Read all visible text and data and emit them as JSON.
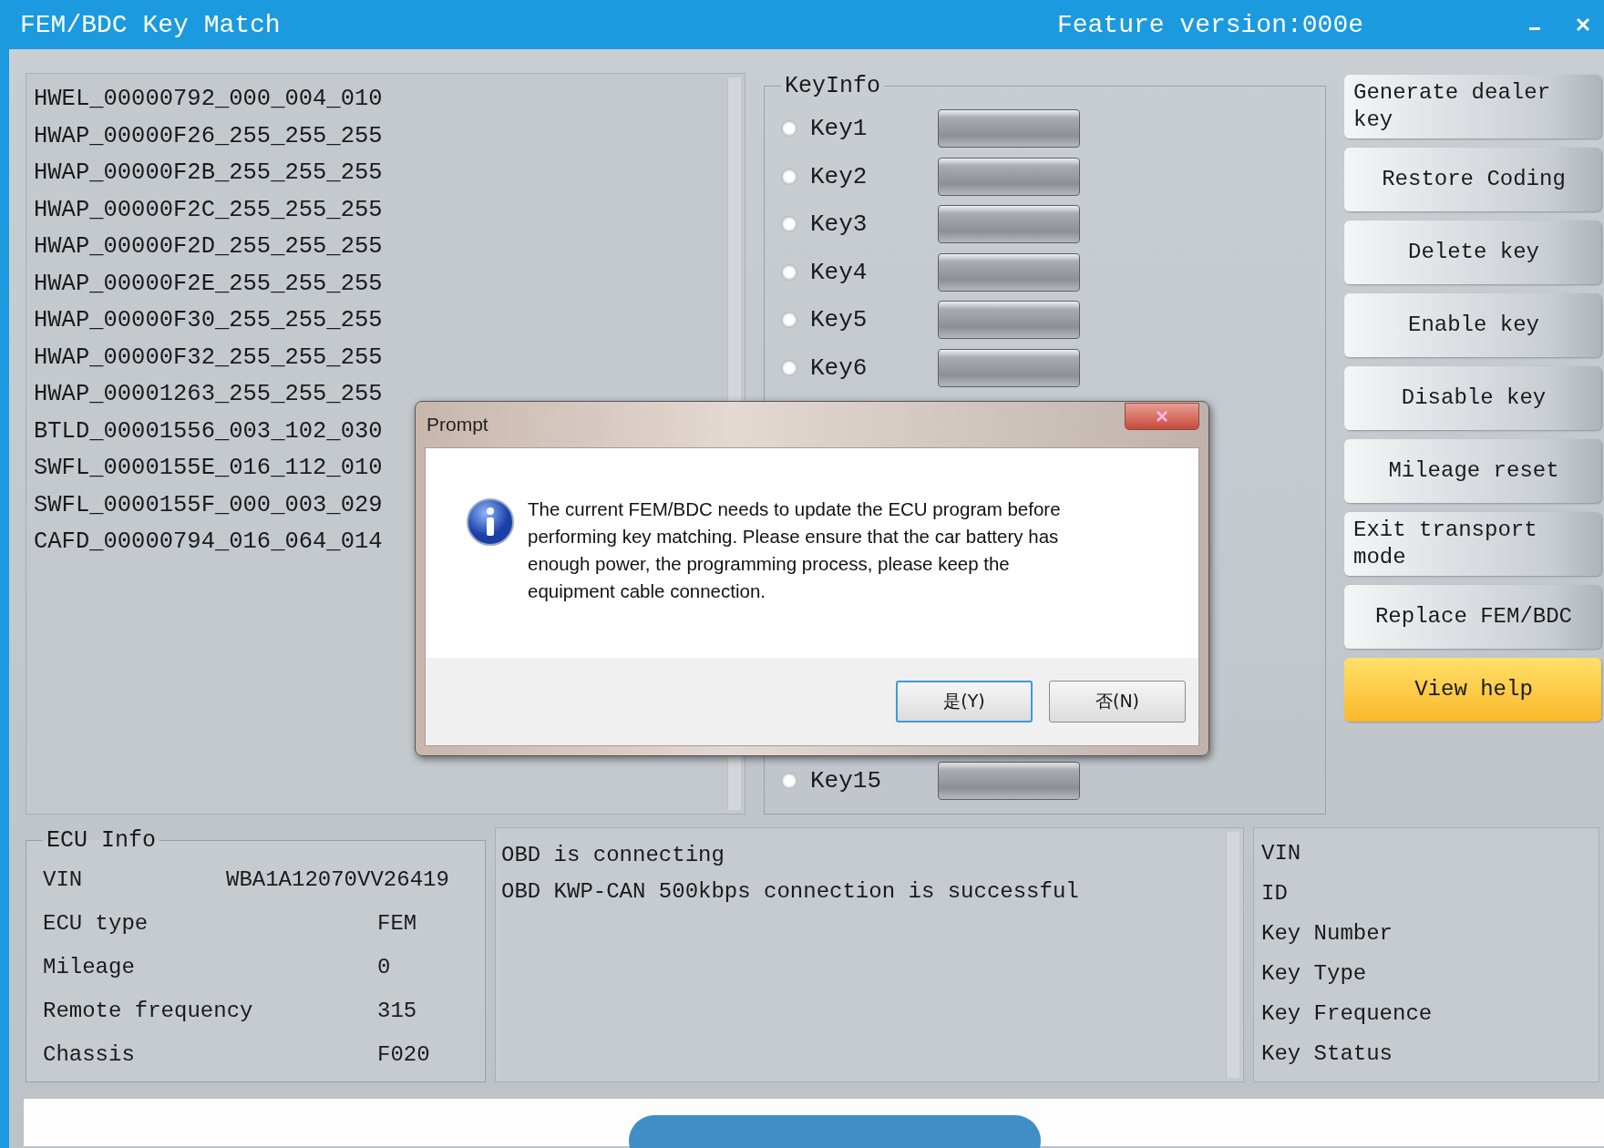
{
  "window": {
    "title": "FEM/BDC Key Match",
    "feature_version": "Feature version:000e"
  },
  "modules": [
    "HWEL_00000792_000_004_010",
    "HWAP_00000F26_255_255_255",
    "HWAP_00000F2B_255_255_255",
    "HWAP_00000F2C_255_255_255",
    "HWAP_00000F2D_255_255_255",
    "HWAP_00000F2E_255_255_255",
    "HWAP_00000F30_255_255_255",
    "HWAP_00000F32_255_255_255",
    "HWAP_00001263_255_255_255",
    "BTLD_00001556_003_102_030",
    "SWFL_0000155E_016_112_010",
    "SWFL_0000155F_000_003_029",
    "CAFD_00000794_016_064_014"
  ],
  "key_info": {
    "title": "KeyInfo",
    "keys_top": [
      {
        "label": "Key1",
        "selected": false
      },
      {
        "label": "Key2",
        "selected": false
      },
      {
        "label": "Key3",
        "selected": false
      },
      {
        "label": "Key4",
        "selected": false
      },
      {
        "label": "Key5",
        "selected": false
      },
      {
        "label": "Key6",
        "selected": false
      }
    ],
    "keys_bottom": [
      {
        "label": "Key15",
        "selected": false
      }
    ]
  },
  "actions": [
    {
      "label": "Generate dealer key",
      "kind": "normal"
    },
    {
      "label": "Restore Coding",
      "kind": "normal"
    },
    {
      "label": "Delete key",
      "kind": "normal"
    },
    {
      "label": "Enable key",
      "kind": "normal"
    },
    {
      "label": "Disable key",
      "kind": "normal"
    },
    {
      "label": "Mileage reset",
      "kind": "normal"
    },
    {
      "label": "Exit transport mode",
      "kind": "normal"
    },
    {
      "label": "Replace FEM/BDC",
      "kind": "normal"
    },
    {
      "label": "View help",
      "kind": "highlight"
    }
  ],
  "ecu_info": {
    "title": "ECU Info",
    "rows": [
      {
        "label": "VIN",
        "value": "WBA1A12070VV26419"
      },
      {
        "label": "ECU type",
        "value": "FEM"
      },
      {
        "label": "Mileage",
        "value": "0"
      },
      {
        "label": "Remote frequency",
        "value": "315"
      },
      {
        "label": "Chassis",
        "value": "F020"
      }
    ]
  },
  "log": [
    "OBD is connecting",
    "OBD KWP-CAN 500kbps connection is successful"
  ],
  "key_details": [
    "VIN",
    "ID",
    "Key Number",
    "Key Type",
    "Key Frequence",
    "Key Status"
  ],
  "dialog": {
    "title": "Prompt",
    "message": "The current FEM/BDC needs to update the ECU program before performing key matching. Please ensure that the car battery has enough power, the programming process, please keep the equipment cable connection.",
    "buttons": [
      {
        "label": "是(Y)",
        "default": true
      },
      {
        "label": "否(N)",
        "default": false
      }
    ]
  }
}
